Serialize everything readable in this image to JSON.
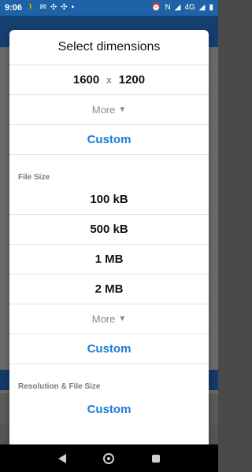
{
  "status_bar": {
    "time": "9:06",
    "left_icons": [
      "walking-icon",
      "mail-icon",
      "sync-icon",
      "sync-icon-2",
      "dot-icon"
    ],
    "network": "4G"
  },
  "dialog": {
    "title": "Select dimensions",
    "width": "1600",
    "times": "x",
    "height": "1200",
    "more_label": "More",
    "custom_label": "Custom",
    "file_size_section": "File Size",
    "file_sizes": [
      "100 kB",
      "500 kB",
      "1 MB",
      "2 MB"
    ],
    "more_label_2": "More",
    "custom_label_2": "Custom",
    "resolution_section": "Resolution & File Size",
    "custom_label_3": "Custom"
  },
  "colors": {
    "status_bar": "#1e63a8",
    "accent": "#1c7cd6"
  }
}
